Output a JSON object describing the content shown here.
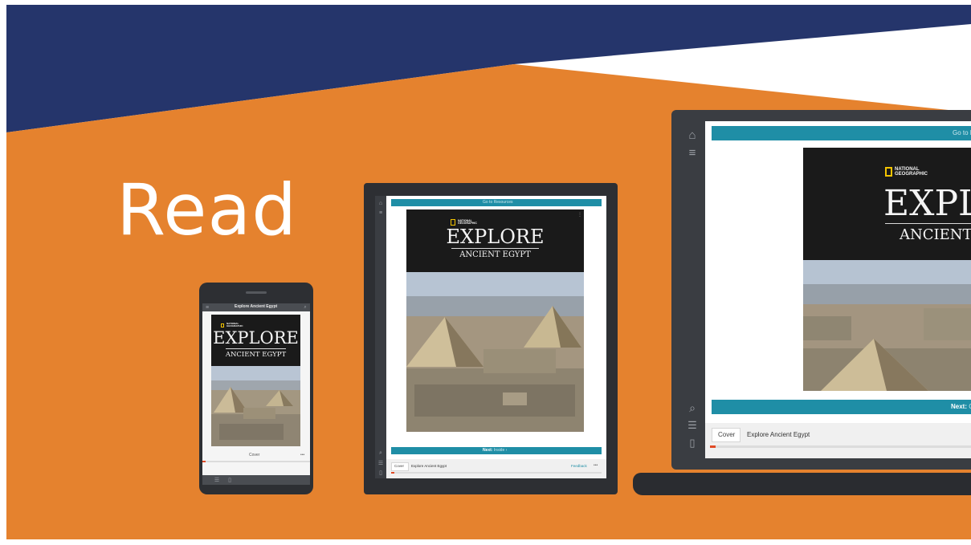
{
  "headline": "Read",
  "book": {
    "publisher_logo_line1": "NATIONAL",
    "publisher_logo_line2": "GEOGRAPHIC",
    "title": "EXPLORE",
    "subtitle": "ANCIENT EGYPT",
    "full_title": "Explore Ancient Egypt"
  },
  "phone": {
    "top_title": "Explore Ancient Egypt",
    "bottom_label": "Cover",
    "more": "•••"
  },
  "tablet": {
    "top_bar": "Go to Resources",
    "next_label": "Next:",
    "next_target": "Inside",
    "footer_cover": "Cover",
    "footer_title": "Explore Ancient Egypt",
    "footer_link": "Feedback",
    "more": "•••"
  },
  "laptop": {
    "top_bar": "Go to R",
    "next_label": "Next:",
    "next_target": "C",
    "footer_cover": "Cover",
    "footer_title": "Explore Ancient Egypt"
  },
  "icons": {
    "home": "home-icon",
    "menu": "menu-icon",
    "search": "search-icon",
    "contents": "contents-icon",
    "book": "book-icon"
  },
  "colors": {
    "navy": "#25356b",
    "orange": "#e5822e",
    "teal": "#1f8ea6",
    "device_frame": "#2d2f33",
    "progress_red": "#e04a26"
  }
}
